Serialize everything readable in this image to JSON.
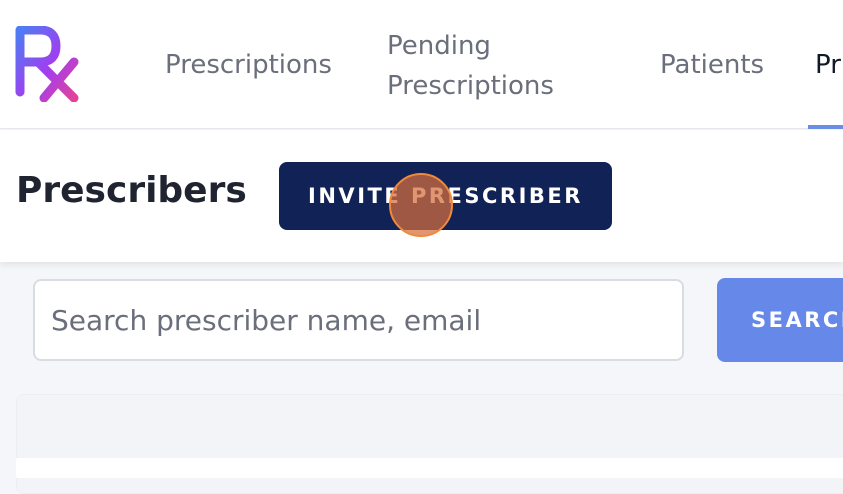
{
  "nav": {
    "logo_text": "Rx",
    "items": [
      {
        "label": "Prescriptions"
      },
      {
        "label_line1": "Pending",
        "label_line2": "Prescriptions"
      },
      {
        "label": "Patients"
      },
      {
        "label": "Pr"
      }
    ]
  },
  "header": {
    "title": "Prescribers",
    "invite_label": "INVITE PRESCRIBER"
  },
  "search": {
    "placeholder": "Search prescriber name, email",
    "value": "",
    "button_label": "SEARCH"
  },
  "colors": {
    "brand_navy": "#112256",
    "accent_blue": "#6688e8",
    "logo_gradient": [
      "#5b6cf0",
      "#a23df0",
      "#e0449a"
    ]
  }
}
